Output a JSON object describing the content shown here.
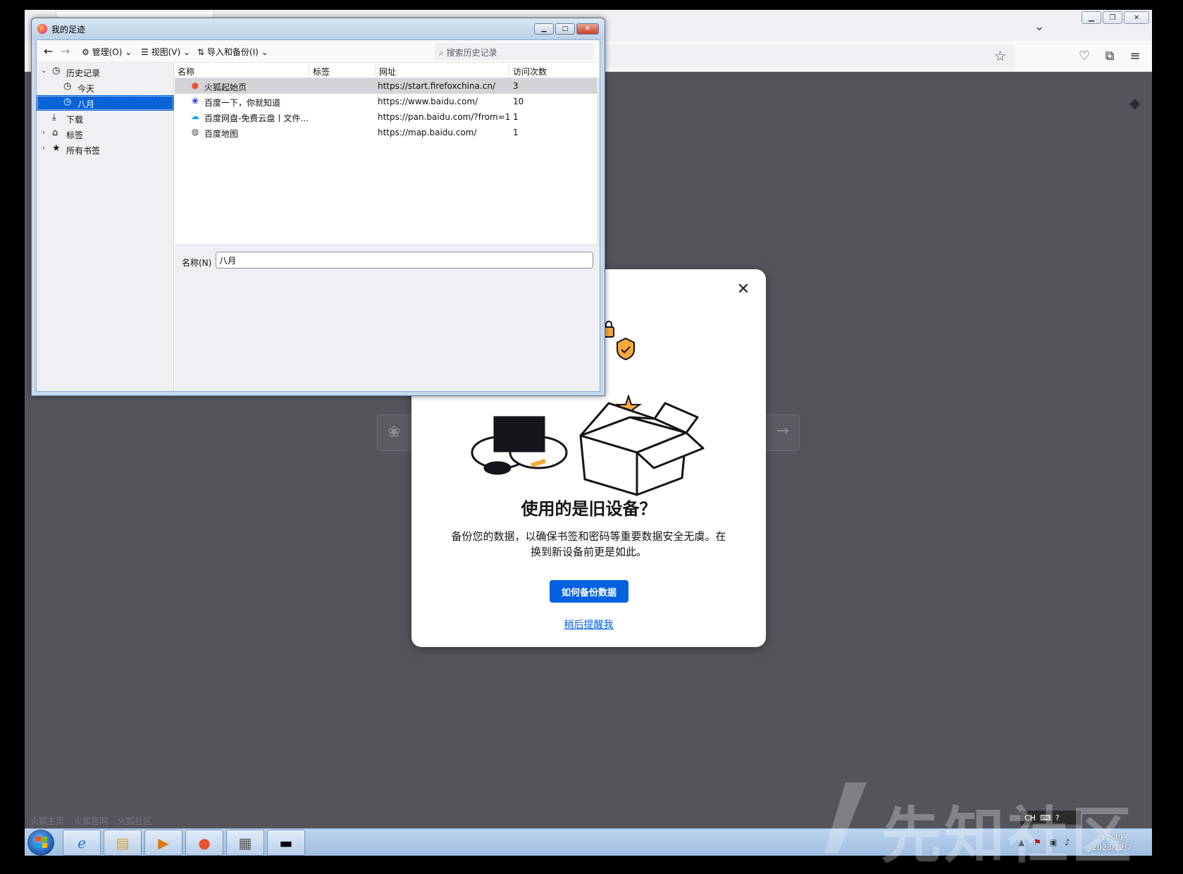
{
  "library": {
    "title": "我的足迹",
    "toolbar": {
      "manage_label": "管理(O)",
      "view_label": "视图(V)",
      "import_label": "导入和备份(I)",
      "search_placeholder": "搜索历史记录"
    },
    "sidebar": {
      "items": [
        {
          "label": "历史记录",
          "icon": "clock-icon"
        },
        {
          "label": "今天",
          "icon": "clock-icon"
        },
        {
          "label": "八月",
          "icon": "clock-icon",
          "selected": true
        },
        {
          "label": "下载",
          "icon": "download-icon"
        },
        {
          "label": "标签",
          "icon": "tag-icon"
        },
        {
          "label": "所有书签",
          "icon": "star-icon"
        }
      ]
    },
    "columns": [
      "名称",
      "标签",
      "网址",
      "访问次数"
    ],
    "rows": [
      {
        "name": "火狐起始页",
        "url": "https://start.firefoxchina.cn/",
        "count": "3",
        "icon": "firefox-icon"
      },
      {
        "name": "百度一下，你就知道",
        "url": "https://www.baidu.com/",
        "count": "10",
        "icon": "baidu-paw-icon"
      },
      {
        "name": "百度网盘-免费云盘丨文件...",
        "url": "https://pan.baidu.com/?from=10...",
        "count": "1",
        "icon": "baidu-pan-icon"
      },
      {
        "name": "百度地图",
        "url": "https://map.baidu.com/",
        "count": "1",
        "icon": "globe-icon"
      }
    ],
    "detail": {
      "name_label": "名称(N)",
      "name_value": "八月"
    }
  },
  "modal": {
    "title": "使用的是旧设备？",
    "body": "备份您的数据，以确保书签和密码等重要数据安全无虞。在换到新设备前更是如此。",
    "primary_button": "如何备份数据",
    "secondary_link": "稍后提醒我"
  },
  "newtab": {
    "bottom_links": [
      "火狐主页",
      "火狐官网",
      "火狐社区"
    ]
  },
  "taskbar": {
    "time": "17:49",
    "date": "2023/12/7",
    "lang": "CH"
  },
  "watermark": "先知社区",
  "colors": {
    "accent": "#0061e0",
    "selection": "#0a64d8",
    "page_bg": "#56545b"
  }
}
